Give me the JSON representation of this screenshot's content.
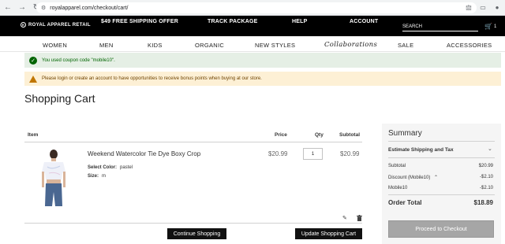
{
  "browser": {
    "url": "royalapparel.com/checkout/cart/",
    "icons": [
      "back-icon",
      "forward-icon",
      "reload-icon",
      "site-info-icon",
      "bookmark-star-icon",
      "extensions-icon",
      "tab-icon",
      "profile-icon"
    ]
  },
  "topbar": {
    "logo_text": "ROYAL APPAREL RETAIL",
    "free_shipping": "$49 FREE SHIPPING OFFER",
    "track_package": "TRACK PACKAGE",
    "help": "HELP",
    "account": "ACCOUNT",
    "search_label": "SEARCH",
    "cart_count": "1"
  },
  "nav": {
    "items": [
      "WOMEN",
      "MEN",
      "KIDS",
      "ORGANIC",
      "NEW STYLES",
      "Collaborations",
      "SALE",
      "ACCESSORIES"
    ]
  },
  "messages": {
    "success": "You used coupon code \"mobile10\".",
    "warning": "Please login or create an account to have opportunities to receive bonus points when buying at our store."
  },
  "page": {
    "title": "Shopping Cart"
  },
  "cart": {
    "headers": {
      "item": "Item",
      "price": "Price",
      "qty": "Qty",
      "subtotal": "Subtotal"
    },
    "rows": [
      {
        "name": "Weekend Watercolor Tie Dye Boxy Crop",
        "color_label": "Select Color:",
        "color_value": "pastel",
        "size_label": "Size:",
        "size_value": "m",
        "price": "$20.99",
        "qty": "1",
        "subtotal": "$20.99"
      }
    ],
    "continue_label": "Continue Shopping",
    "update_label": "Update Shopping Cart"
  },
  "summary": {
    "title": "Summary",
    "estimate_label": "Estimate Shipping and Tax",
    "subtotal_label": "Subtotal",
    "subtotal_value": "$20.99",
    "discount_label": "Discount (Mobile10)",
    "discount_value": "-$2.10",
    "coupon_label": "Mobile10",
    "coupon_value": "-$2.10",
    "order_total_label": "Order Total",
    "order_total_value": "$18.89",
    "checkout_label": "Proceed to Checkout"
  },
  "colors": {
    "success_bg": "#e5efe5",
    "success_text": "#006400",
    "warning_bg": "#fdf0d5",
    "topbar_bg": "#000000",
    "button_dark": "#111111",
    "checkout_disabled": "#a6a6a6"
  }
}
